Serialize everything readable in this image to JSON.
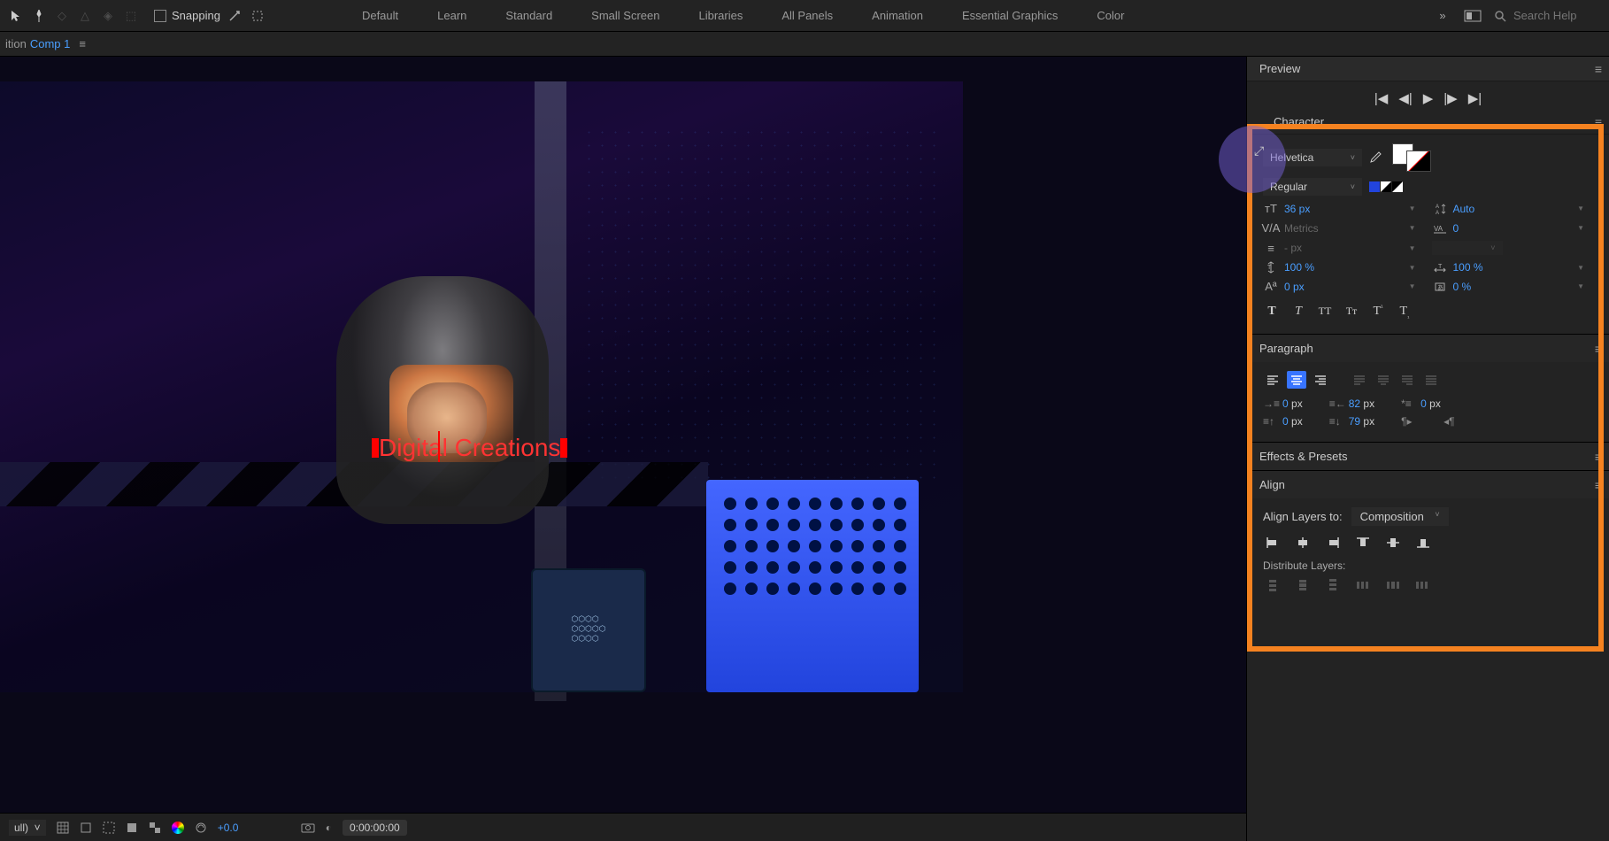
{
  "toolbar": {
    "snapping_label": "Snapping"
  },
  "workspaces": {
    "items": [
      "Default",
      "Learn",
      "Standard",
      "Small Screen",
      "Libraries",
      "All Panels",
      "Animation",
      "Essential Graphics",
      "Color"
    ]
  },
  "search": {
    "placeholder": "Search Help"
  },
  "composition": {
    "prefix": "ition",
    "name": "Comp 1"
  },
  "preview": {
    "title": "Preview"
  },
  "character": {
    "title": "Character",
    "font_family": "Helvetica",
    "font_style": "Regular",
    "font_size": "36 px",
    "leading": "Auto",
    "kerning": "Metrics",
    "tracking": "0",
    "stroke_width": "- px",
    "v_scale": "100 %",
    "h_scale": "100 %",
    "baseline": "0 px",
    "tsume": "0 %"
  },
  "paragraph": {
    "title": "Paragraph",
    "indent_left": "0",
    "indent_right": "82",
    "indent_first": "0",
    "space_before": "0",
    "space_after": "79",
    "px": "px"
  },
  "effects": {
    "title": "Effects & Presets"
  },
  "align": {
    "title": "Align",
    "layers_to_label": "Align Layers to:",
    "layers_to_value": "Composition",
    "distribute_label": "Distribute Layers:"
  },
  "viewport": {
    "text_content": "Digital Creations",
    "resolution": "ull)",
    "exposure": "+0.0",
    "timecode": "0:00:00:00"
  }
}
